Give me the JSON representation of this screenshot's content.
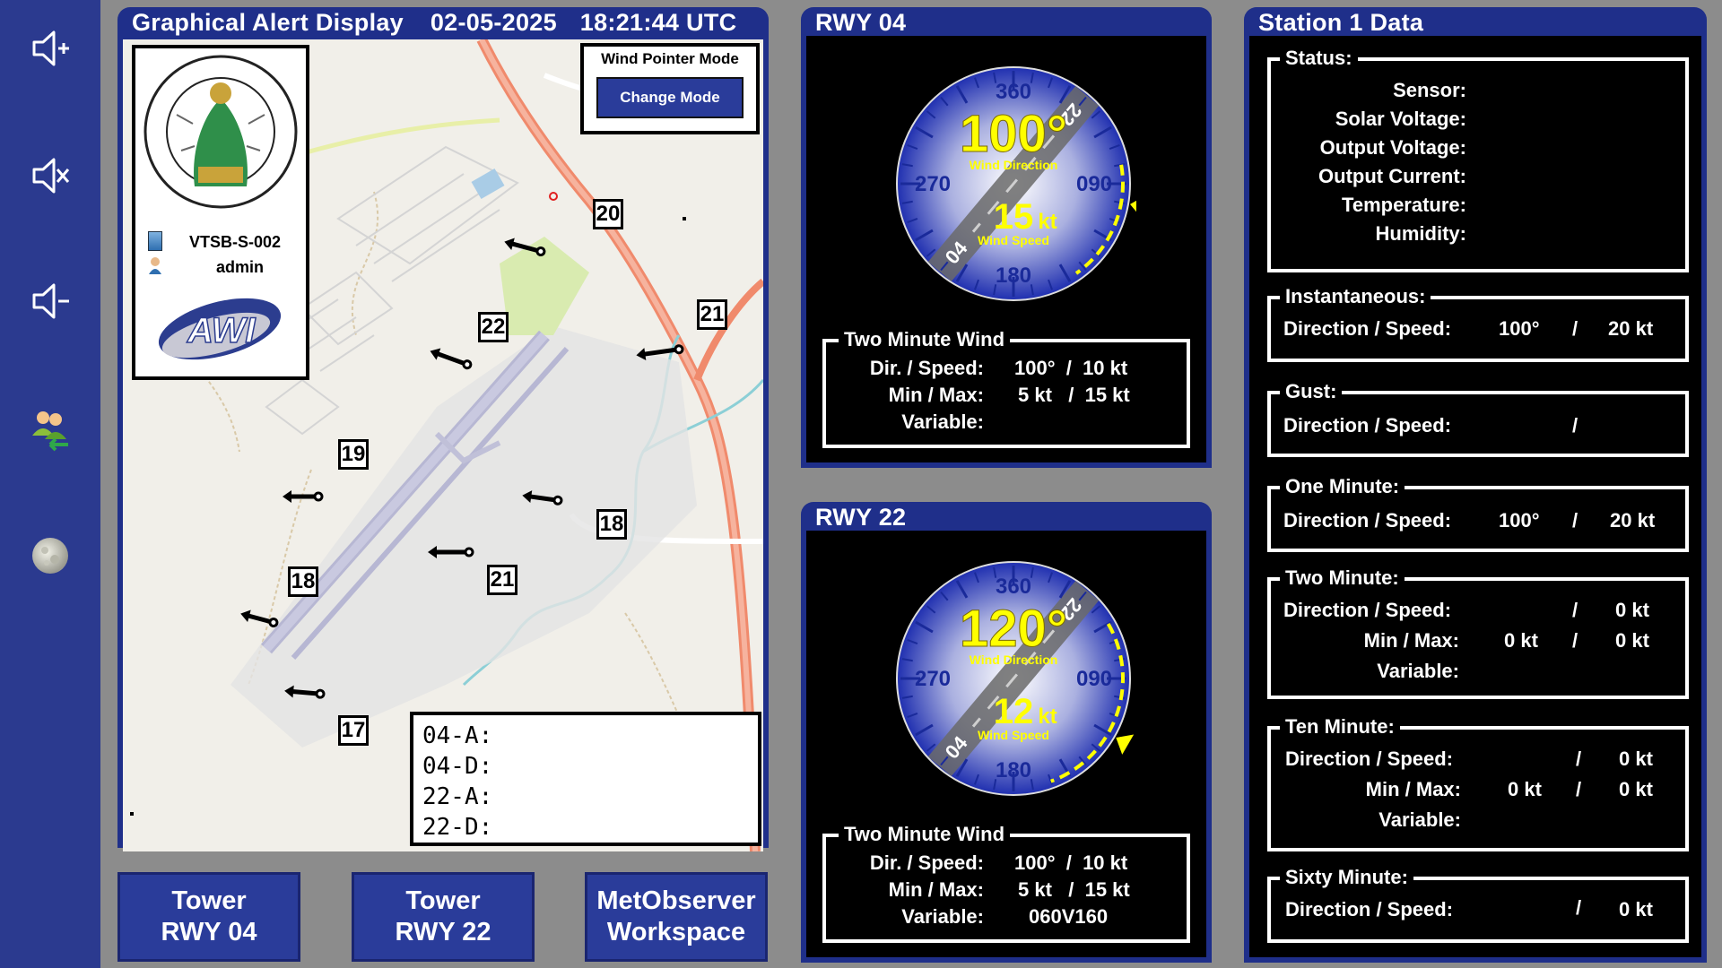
{
  "header": {
    "title": "Graphical Alert Display",
    "date": "02-05-2025",
    "time": "18:21:44 UTC"
  },
  "sidebar": {
    "items": [
      {
        "icon": "volume-up-icon"
      },
      {
        "icon": "volume-mute-icon"
      },
      {
        "icon": "volume-down-icon"
      },
      {
        "icon": "users-logout-icon"
      },
      {
        "icon": "moon-icon"
      }
    ]
  },
  "map": {
    "station_id": "VTSB-S-002",
    "user": "admin",
    "mode_label": "Wind Pointer Mode",
    "change_mode_button": "Change Mode",
    "markers": [
      "20",
      "22",
      "21",
      "19",
      "18",
      "21",
      "18",
      "17"
    ],
    "alerts": [
      {
        "label": "04-A:",
        "value": ""
      },
      {
        "label": "04-D:",
        "value": ""
      },
      {
        "label": "22-A:",
        "value": ""
      },
      {
        "label": "22-D:",
        "value": ""
      }
    ]
  },
  "rwy04": {
    "title": "RWY 04",
    "dial": {
      "n": "360",
      "w": "270",
      "e": "090",
      "s": "180",
      "runway_top": "22",
      "runway_bottom": "04",
      "direction": "100°",
      "direction_label": "Wind Direction",
      "speed": "15",
      "speed_unit": "kt",
      "speed_label": "Wind Speed",
      "pointer_deg": 100,
      "arc_from_deg": 80,
      "arc_to_deg": 145
    },
    "two_minute": {
      "legend": "Two Minute Wind",
      "dir_speed_label": "Dir. / Speed:",
      "dir_speed_value": "100°  /  10 kt",
      "minmax_label": "Min / Max:",
      "minmax_value": "5 kt   /  15 kt",
      "variable_label": "Variable:",
      "variable_value": ""
    }
  },
  "rwy22": {
    "title": "RWY 22",
    "dial": {
      "n": "360",
      "w": "270",
      "e": "090",
      "s": "180",
      "runway_top": "22",
      "runway_bottom": "04",
      "direction": "120°",
      "direction_label": "Wind Direction",
      "speed": "12",
      "speed_unit": "kt",
      "speed_label": "Wind Speed",
      "pointer_deg": 120,
      "arc_from_deg": 60,
      "arc_to_deg": 160
    },
    "two_minute": {
      "legend": "Two Minute Wind",
      "dir_speed_label": "Dir. / Speed:",
      "dir_speed_value": "100°  /  10 kt",
      "minmax_label": "Min / Max:",
      "minmax_value": "5 kt   /  15 kt",
      "variable_label": "Variable:",
      "variable_value": "060V160"
    }
  },
  "station": {
    "title": "Station 1 Data",
    "status": {
      "legend": "Status:",
      "sensor": "Sensor:",
      "solar": "Solar Voltage:",
      "output_v": "Output Voltage:",
      "output_c": "Output Current:",
      "temperature": "Temperature:",
      "humidity": "Humidity:"
    },
    "instantaneous": {
      "legend": "Instantaneous:",
      "label": "Direction / Speed:",
      "dir": "100°",
      "sep": "/",
      "speed": "20 kt"
    },
    "gust": {
      "legend": "Gust:",
      "label": "Direction / Speed:",
      "dir": "",
      "sep": "/",
      "speed": ""
    },
    "one_minute": {
      "legend": "One Minute:",
      "label": "Direction / Speed:",
      "dir": "100°",
      "sep": "/",
      "speed": "20 kt"
    },
    "two_minute": {
      "legend": "Two Minute:",
      "label": "Direction / Speed:",
      "dir": "",
      "sep": "/",
      "speed": "0 kt",
      "minmax_label": "Min / Max:",
      "min": "0 kt",
      "max": "0 kt",
      "variable_label": "Variable:"
    },
    "ten_minute": {
      "legend": "Ten Minute:",
      "label": "Direction / Speed:",
      "dir": "",
      "sep": "/",
      "speed": "0 kt",
      "minmax_label": "Min / Max:",
      "min": "0 kt",
      "max": "0 kt",
      "variable_label": "Variable:"
    },
    "sixty_minute": {
      "legend": "Sixty Minute:",
      "label": "Direction / Speed:",
      "dir": "",
      "sep": "/",
      "speed": "0 kt"
    }
  },
  "buttons": {
    "tower04_line1": "Tower",
    "tower04_line2": "RWY 04",
    "tower22_line1": "Tower",
    "tower22_line2": "RWY 22",
    "met_line1": "MetObserver",
    "met_line2": "Workspace"
  },
  "colors": {
    "panel_blue": "#1f2f8a",
    "sidebar_blue": "#2b3a8f",
    "dial_yellow": "#ffff00"
  }
}
